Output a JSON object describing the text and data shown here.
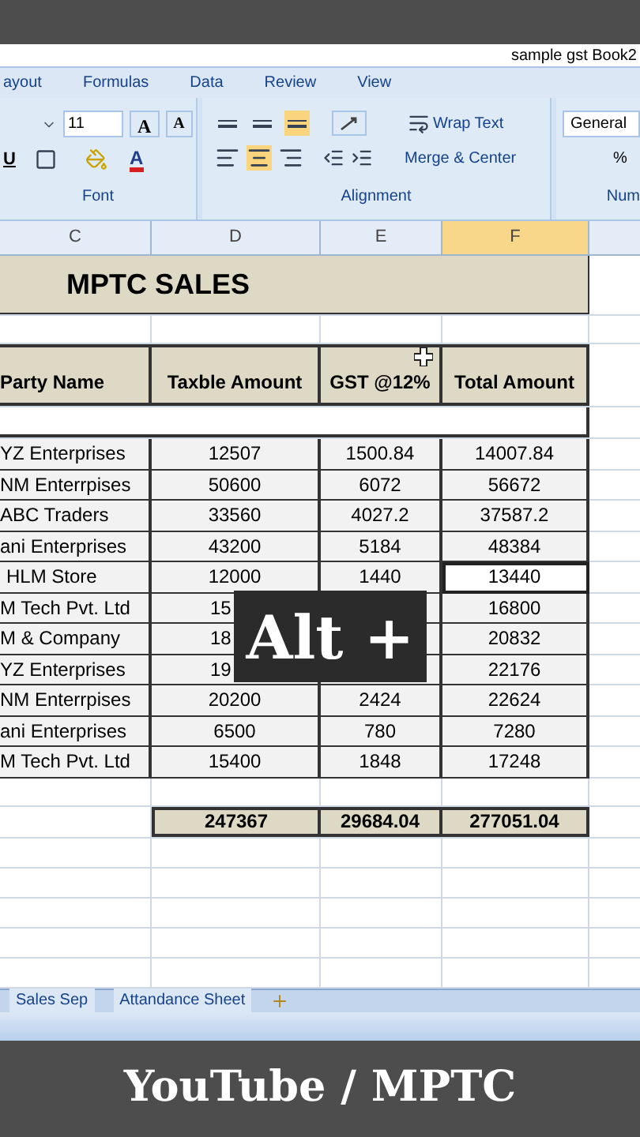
{
  "window": {
    "title": "sample gst Book2"
  },
  "ribbon_tabs": [
    {
      "label": "ayout",
      "selected": false
    },
    {
      "label": "Formulas",
      "selected": false
    },
    {
      "label": "Data",
      "selected": false
    },
    {
      "label": "Review",
      "selected": false
    },
    {
      "label": "View",
      "selected": false
    }
  ],
  "font_group": {
    "size": "11",
    "grow": "A",
    "shrink": "A",
    "underline": "U",
    "font_color": "A",
    "label": "Font"
  },
  "alignment_group": {
    "wrap": "Wrap Text",
    "merge": "Merge & Center",
    "label": "Alignment",
    "vertical_align": [
      {
        "selected": false
      },
      {
        "selected": false
      },
      {
        "selected": true
      }
    ],
    "horizontal_align": [
      {
        "selected": false
      },
      {
        "selected": true
      },
      {
        "selected": false
      }
    ]
  },
  "number_group": {
    "format": "General",
    "percent": "%",
    "label": "Num"
  },
  "columns": [
    {
      "label": "C",
      "selected": false
    },
    {
      "label": "D",
      "selected": false
    },
    {
      "label": "E",
      "selected": false
    },
    {
      "label": "F",
      "selected": true
    }
  ],
  "sheet_title": "MPTC SALES",
  "headers": [
    "Party Name",
    "Taxble Amount",
    "GST @12%",
    "Total Amount"
  ],
  "rows": [
    {
      "party": "YZ Enterprises",
      "taxable": "12507",
      "gst": "1500.84",
      "total": "14007.84",
      "selected": false,
      "covered": false
    },
    {
      "party": "NM Enterrpises",
      "taxable": "50600",
      "gst": "6072",
      "total": "56672",
      "selected": false,
      "covered": false
    },
    {
      "party": "ABC Traders",
      "taxable": "33560",
      "gst": "4027.2",
      "total": "37587.2",
      "selected": false,
      "covered": false
    },
    {
      "party": "ani Enterprises",
      "taxable": "43200",
      "gst": "5184",
      "total": "48384",
      "selected": false,
      "covered": false
    },
    {
      "party": "HLM Store",
      "taxable": "12000",
      "gst": "1440",
      "total": "13440",
      "selected": true,
      "covered": false
    },
    {
      "party": "M Tech Pvt. Ltd",
      "taxable": "15",
      "total": "16800",
      "selected": false,
      "covered": true
    },
    {
      "party": "M & Company",
      "taxable": "18",
      "total": "20832",
      "selected": false,
      "covered": true
    },
    {
      "party": "YZ Enterprises",
      "taxable": "19",
      "total": "22176",
      "selected": false,
      "covered": true
    },
    {
      "party": "NM Enterrpises",
      "taxable": "20200",
      "gst": "2424",
      "total": "22624",
      "selected": false,
      "covered": false
    },
    {
      "party": "ani Enterprises",
      "taxable": "6500",
      "gst": "780",
      "total": "7280",
      "selected": false,
      "covered": false
    },
    {
      "party": "M Tech Pvt. Ltd",
      "taxable": "15400",
      "gst": "1848",
      "total": "17248",
      "selected": false,
      "covered": false
    }
  ],
  "totals": {
    "taxable": "247367",
    "gst": "29684.04",
    "total": "277051.04"
  },
  "sheet_tabs": [
    {
      "label": "Sales Sep",
      "selected": false
    },
    {
      "label": "Attandance Sheet",
      "selected": false
    }
  ],
  "overlay_caption": "Alt +",
  "footer_caption": "YouTube / MPTC"
}
